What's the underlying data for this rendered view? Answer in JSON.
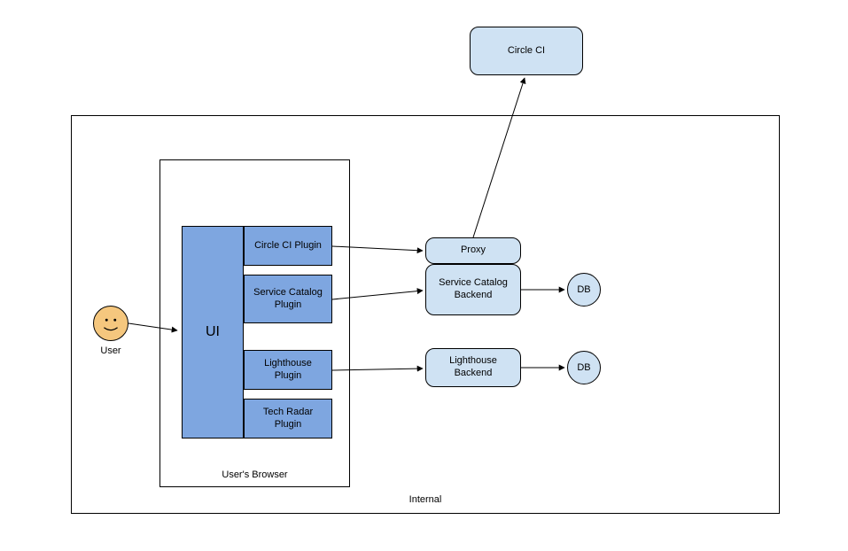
{
  "nodes": {
    "circleci": "Circle CI",
    "user": "User",
    "ui": "UI",
    "circleci_plugin": "Circle CI Plugin",
    "service_catalog_plugin": "Service Catalog Plugin",
    "lighthouse_plugin": "Lighthouse Plugin",
    "tech_radar_plugin": "Tech Radar Plugin",
    "proxy": "Proxy",
    "service_catalog_backend": "Service Catalog Backend",
    "lighthouse_backend": "Lighthouse Backend",
    "db1": "DB",
    "db2": "DB"
  },
  "containers": {
    "internal": "Internal",
    "browser": "User's Browser"
  }
}
